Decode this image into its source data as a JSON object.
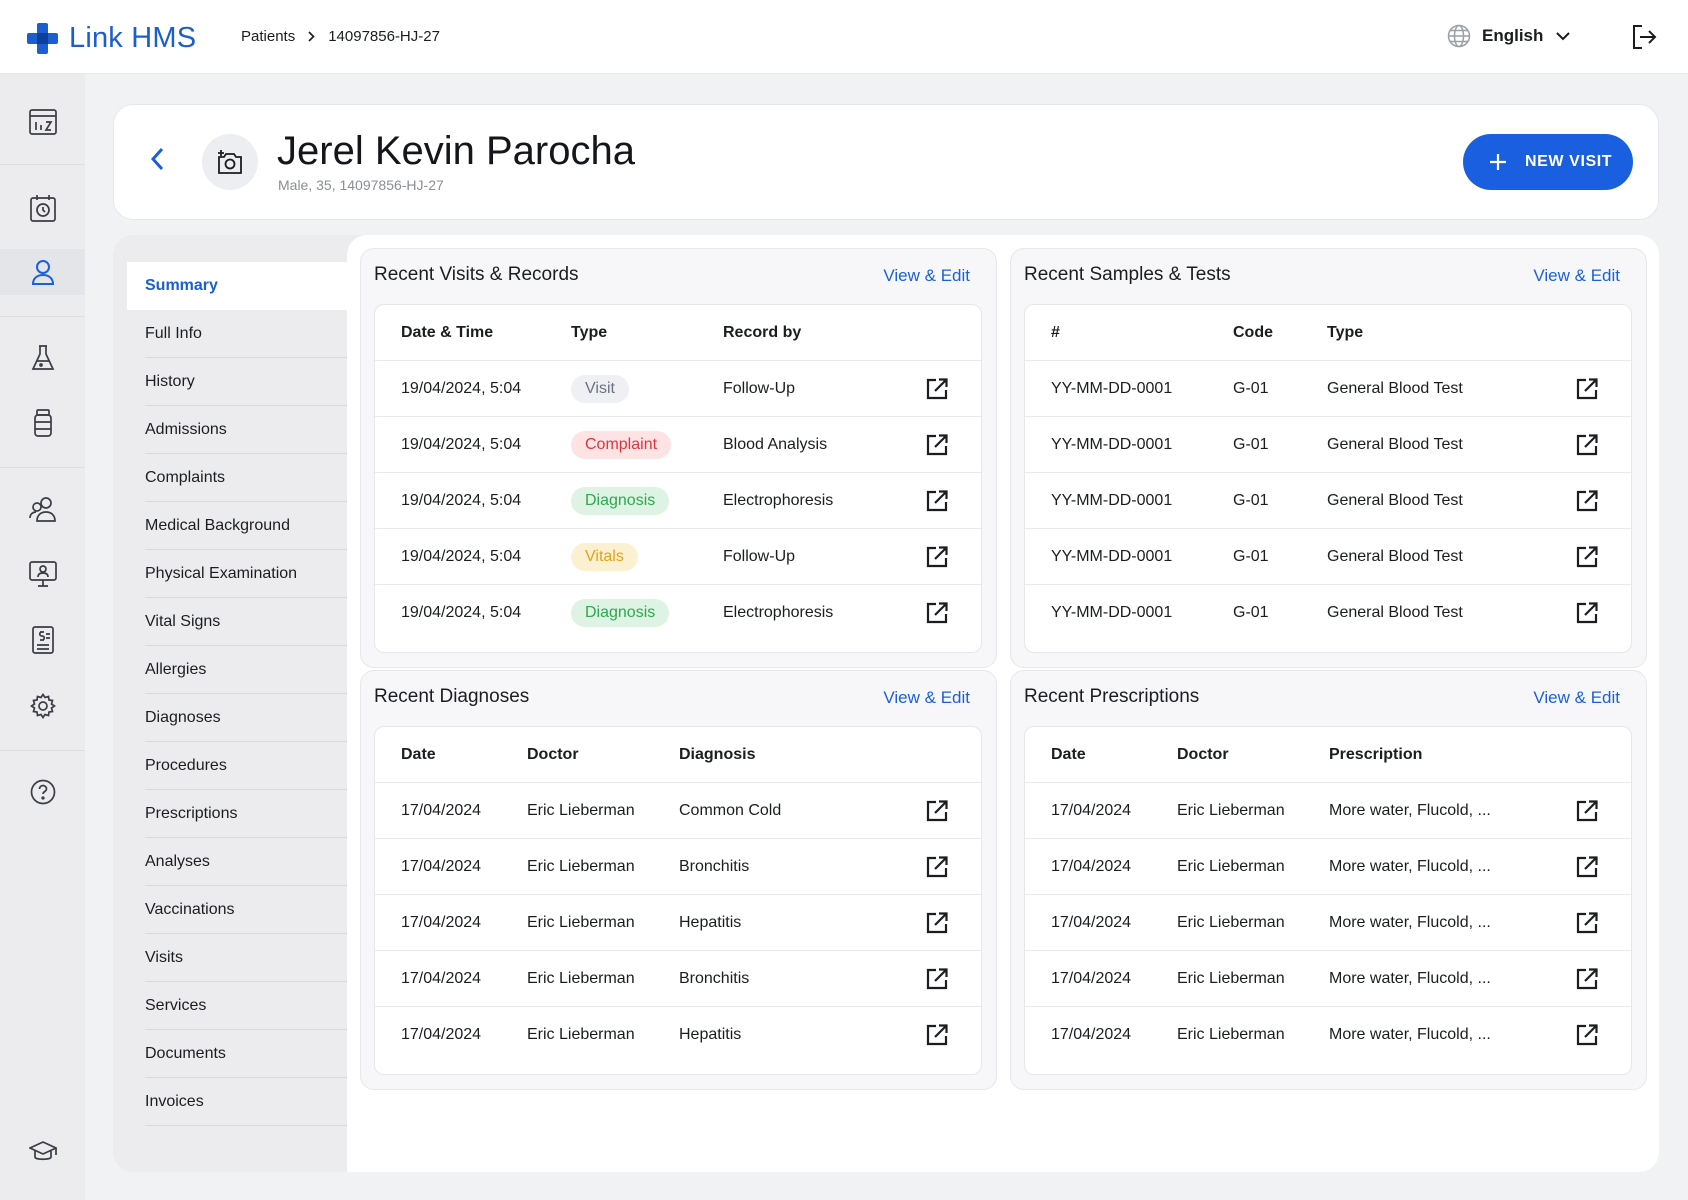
{
  "app": {
    "logo_text": "Link HMS"
  },
  "breadcrumb": {
    "items": [
      "Patients",
      "14097856-HJ-27"
    ]
  },
  "language": {
    "label": "English"
  },
  "rail": {
    "icons": [
      "dashboard-icon",
      "appointments-icon",
      "patients-icon",
      "lab-icon",
      "pharmacy-icon",
      "staff-icon",
      "monitor-icon",
      "billing-icon",
      "settings-icon",
      "help-icon",
      "training-icon"
    ]
  },
  "patient": {
    "name": "Jerel Kevin Parocha",
    "meta": "Male, 35, 14097856-HJ-27"
  },
  "actions": {
    "new_visit": "NEW VISIT"
  },
  "subnav": {
    "items": [
      "Summary",
      "Full Info",
      "History",
      "Admissions",
      "Complaints",
      "Medical Background",
      "Physical Examination",
      "Vital Signs",
      "Allergies",
      "Diagnoses",
      "Procedures",
      "Prescriptions",
      "Analyses",
      "Vaccinations",
      "Visits",
      "Services",
      "Documents",
      "Invoices"
    ],
    "active": "Summary"
  },
  "colors": {
    "accent": "#1a5fe0",
    "visit": "#6b7280",
    "complaint": "#e0343d",
    "diagnosis": "#2fa84f",
    "vitals": "#e0a21a"
  },
  "cards": {
    "visits": {
      "title": "Recent Visits & Records",
      "link": "View & Edit",
      "headers": [
        "Date & Time",
        "Type",
        "Record by"
      ],
      "rows": [
        {
          "date": "19/04/2024, 5:04",
          "type": "Visit",
          "record_by": "Follow-Up"
        },
        {
          "date": "19/04/2024, 5:04",
          "type": "Complaint",
          "record_by": "Blood Analysis"
        },
        {
          "date": "19/04/2024, 5:04",
          "type": "Diagnosis",
          "record_by": "Electrophoresis"
        },
        {
          "date": "19/04/2024, 5:04",
          "type": "Vitals",
          "record_by": "Follow-Up"
        },
        {
          "date": "19/04/2024, 5:04",
          "type": "Diagnosis",
          "record_by": "Electrophoresis"
        }
      ]
    },
    "samples": {
      "title": "Recent Samples & Tests",
      "link": "View & Edit",
      "headers": [
        "#",
        "Code",
        "Type"
      ],
      "rows": [
        {
          "id": "YY-MM-DD-0001",
          "code": "G-01",
          "type": "General Blood Test"
        },
        {
          "id": "YY-MM-DD-0001",
          "code": "G-01",
          "type": "General Blood Test"
        },
        {
          "id": "YY-MM-DD-0001",
          "code": "G-01",
          "type": "General Blood Test"
        },
        {
          "id": "YY-MM-DD-0001",
          "code": "G-01",
          "type": "General Blood Test"
        },
        {
          "id": "YY-MM-DD-0001",
          "code": "G-01",
          "type": "General Blood Test"
        }
      ]
    },
    "diagnoses": {
      "title": "Recent Diagnoses",
      "link": "View & Edit",
      "headers": [
        "Date",
        "Doctor",
        "Diagnosis"
      ],
      "rows": [
        {
          "date": "17/04/2024",
          "doctor": "Eric Lieberman",
          "value": "Common Cold"
        },
        {
          "date": "17/04/2024",
          "doctor": "Eric Lieberman",
          "value": "Bronchitis"
        },
        {
          "date": "17/04/2024",
          "doctor": "Eric Lieberman",
          "value": "Hepatitis"
        },
        {
          "date": "17/04/2024",
          "doctor": "Eric Lieberman",
          "value": "Bronchitis"
        },
        {
          "date": "17/04/2024",
          "doctor": "Eric Lieberman",
          "value": "Hepatitis"
        }
      ]
    },
    "prescriptions": {
      "title": "Recent Prescriptions",
      "link": "View & Edit",
      "headers": [
        "Date",
        "Doctor",
        "Prescription"
      ],
      "rows": [
        {
          "date": "17/04/2024",
          "doctor": "Eric Lieberman",
          "value": "More water, Flucold, ..."
        },
        {
          "date": "17/04/2024",
          "doctor": "Eric Lieberman",
          "value": "More water, Flucold, ..."
        },
        {
          "date": "17/04/2024",
          "doctor": "Eric Lieberman",
          "value": "More water, Flucold, ..."
        },
        {
          "date": "17/04/2024",
          "doctor": "Eric Lieberman",
          "value": "More water, Flucold, ..."
        },
        {
          "date": "17/04/2024",
          "doctor": "Eric Lieberman",
          "value": "More water, Flucold, ..."
        }
      ]
    }
  }
}
